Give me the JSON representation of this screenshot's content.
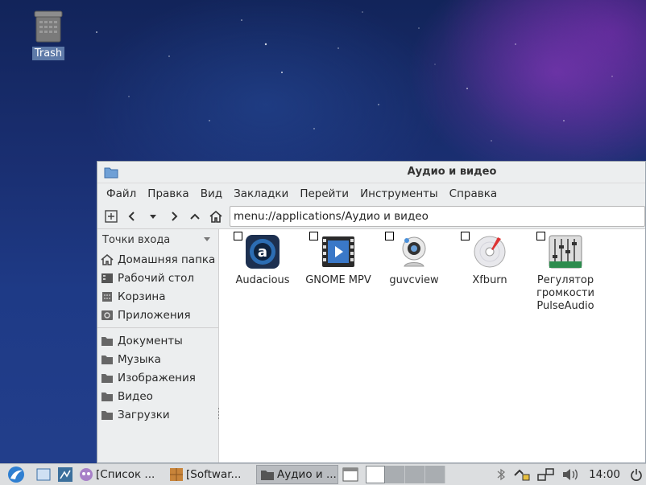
{
  "desktop": {
    "trash_label": "Trash"
  },
  "window": {
    "title": "Аудио и видео",
    "menu": [
      "Файл",
      "Правка",
      "Вид",
      "Закладки",
      "Перейти",
      "Инструменты",
      "Справка"
    ],
    "address": "menu://applications/Аудио и видео"
  },
  "sidebar": {
    "header": "Точки входа",
    "places": [
      {
        "label": "Домашняя папка",
        "icon": "home-icon"
      },
      {
        "label": "Рабочий стол",
        "icon": "desktop-icon"
      },
      {
        "label": "Корзина",
        "icon": "trash-icon"
      },
      {
        "label": "Приложения",
        "icon": "applications-icon"
      }
    ],
    "bookmarks": [
      {
        "label": "Документы",
        "icon": "folder-icon"
      },
      {
        "label": "Музыка",
        "icon": "folder-icon"
      },
      {
        "label": "Изображения",
        "icon": "folder-icon"
      },
      {
        "label": "Видео",
        "icon": "folder-icon"
      },
      {
        "label": "Загрузки",
        "icon": "folder-icon"
      }
    ]
  },
  "apps": [
    {
      "label": "Audacious",
      "icon": "audacious-icon"
    },
    {
      "label": "GNOME MPV",
      "icon": "mpv-icon"
    },
    {
      "label": "guvcview",
      "icon": "webcam-icon"
    },
    {
      "label": "Xfburn",
      "icon": "disc-burn-icon"
    },
    {
      "label": "Регулятор громкости PulseAudio",
      "icon": "mixer-icon"
    }
  ],
  "taskbar": {
    "tasks": [
      {
        "label": "[Список ...",
        "icon": "qbittorrent-icon"
      },
      {
        "label": "[Softwar...",
        "icon": "package-icon"
      },
      {
        "label": "Аудио и ...",
        "icon": "folder-icon",
        "active": true
      }
    ],
    "clock": "14:00"
  },
  "colors": {
    "accent": "#5e7aa8",
    "window_bg": "#eceeef"
  }
}
